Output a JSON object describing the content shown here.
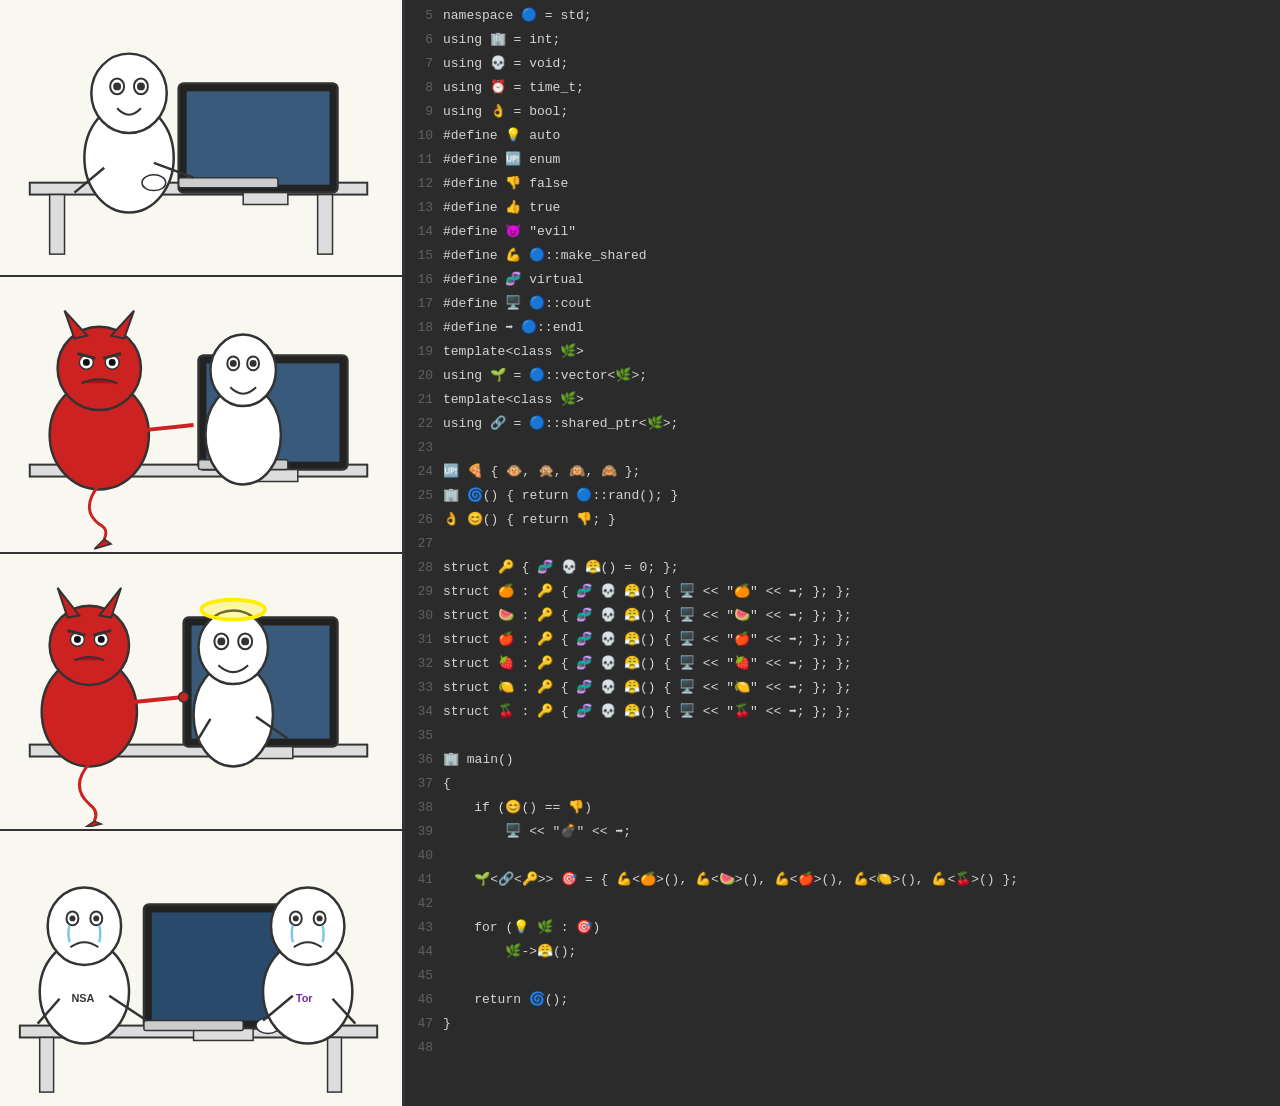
{
  "comic": {
    "panels": [
      {
        "id": "panel-1",
        "description": "Person sitting at computer looking scared/concerned"
      },
      {
        "id": "panel-2",
        "description": "Devil figure menacing person at computer"
      },
      {
        "id": "panel-3",
        "description": "Devil pointing at computer with glowing halo person"
      },
      {
        "id": "panel-4",
        "description": "Two people crying at computer, one wearing NSA shirt, other Tor"
      }
    ]
  },
  "code": {
    "lines": [
      {
        "num": 5,
        "content": "namespace 🔵 = std;"
      },
      {
        "num": 6,
        "content": "using 🏢 = int;"
      },
      {
        "num": 7,
        "content": "using 💀 = void;"
      },
      {
        "num": 8,
        "content": "using ⏰ = time_t;"
      },
      {
        "num": 9,
        "content": "using 👌 = bool;"
      },
      {
        "num": 10,
        "content": "#define 💡 auto"
      },
      {
        "num": 11,
        "content": "#define 🆙 enum"
      },
      {
        "num": 12,
        "content": "#define 👎 false"
      },
      {
        "num": 13,
        "content": "#define 👍 true"
      },
      {
        "num": 14,
        "content": "#define 😈 \"evil\""
      },
      {
        "num": 15,
        "content": "#define 💪 🔵::make_shared"
      },
      {
        "num": 16,
        "content": "#define 🧬 virtual"
      },
      {
        "num": 17,
        "content": "#define 🖥️ 🔵::cout"
      },
      {
        "num": 18,
        "content": "#define ➡️ 🔵::endl"
      },
      {
        "num": 19,
        "content": "template<class 🌿>"
      },
      {
        "num": 20,
        "content": "using 🌱 = 🔵::vector<🌿>;"
      },
      {
        "num": 21,
        "content": "template<class 🌿>"
      },
      {
        "num": 22,
        "content": "using 🔗 = 🔵::shared_ptr<🌿>;"
      },
      {
        "num": 23,
        "content": ""
      },
      {
        "num": 24,
        "content": "🆙 🍕 { 🐵, 🙊, 🙉, 🙈 };"
      },
      {
        "num": 25,
        "content": "🏢 🌀() { return 🔵::rand(); }"
      },
      {
        "num": 26,
        "content": "👌 😊() { return 👎; }"
      },
      {
        "num": 27,
        "content": ""
      },
      {
        "num": 28,
        "content": "struct 🔑 { 🧬 💀 😤() = 0; };"
      },
      {
        "num": 29,
        "content": "struct 🍊 : 🔑 { 🧬 💀 😤() { 🖥️ << \"🍊\" << ➡️; }; };"
      },
      {
        "num": 30,
        "content": "struct 🍉 : 🔑 { 🧬 💀 😤() { 🖥️ << \"🍉\" << ➡️; }; };"
      },
      {
        "num": 31,
        "content": "struct 🍎 : 🔑 { 🧬 💀 😤() { 🖥️ << \"🍎\" << ➡️; }; };"
      },
      {
        "num": 32,
        "content": "struct 🍓 : 🔑 { 🧬 💀 😤() { 🖥️ << \"🍓\" << ➡️; }; };"
      },
      {
        "num": 33,
        "content": "struct 🍋 : 🔑 { 🧬 💀 😤() { 🖥️ << \"🍋\" << ➡️; }; };"
      },
      {
        "num": 34,
        "content": "struct 🍒 : 🔑 { 🧬 💀 😤() { 🖥️ << \"🍒\" << ➡️; }; };"
      },
      {
        "num": 35,
        "content": ""
      },
      {
        "num": 36,
        "content": "🏢 main()"
      },
      {
        "num": 37,
        "content": "{"
      },
      {
        "num": 38,
        "content": "    if (😊() == 👎)"
      },
      {
        "num": 39,
        "content": "        🖥️ << \"💣\" << ➡️;"
      },
      {
        "num": 40,
        "content": ""
      },
      {
        "num": 41,
        "content": "    🌱<🔗<🔑>> 🎯 = { 💪<🍊>(), 💪<🍉>(), 💪<🍎>(), 💪<🍋>(), 💪<🍒>() };"
      },
      {
        "num": 42,
        "content": ""
      },
      {
        "num": 43,
        "content": "    for (💡 🌿 : 🎯)"
      },
      {
        "num": 44,
        "content": "        🌿->😤();"
      },
      {
        "num": 45,
        "content": ""
      },
      {
        "num": 46,
        "content": "    return 🌀();"
      },
      {
        "num": 47,
        "content": "}"
      },
      {
        "num": 48,
        "content": ""
      }
    ]
  }
}
